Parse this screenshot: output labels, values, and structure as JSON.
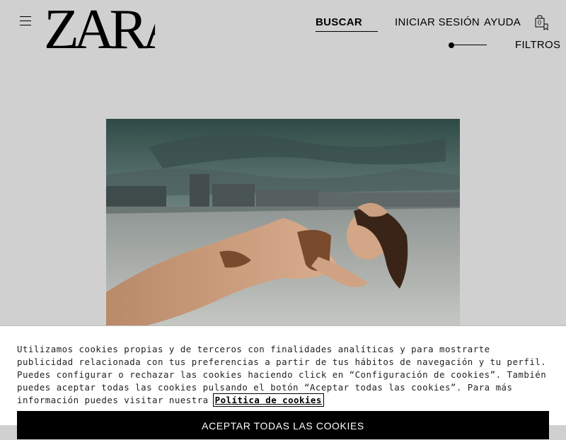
{
  "header": {
    "logo_text": "ZARA",
    "search_label": "BUSCAR",
    "login_label": "INICIAR SESIÓN",
    "help_label": "AYUDA",
    "bag_count": "0",
    "filters_label": "FILTROS"
  },
  "cookie_banner": {
    "text": "Utilizamos cookies propias y de terceros con finalidades analíticas y para mostrarte publicidad relacionada con tus preferencias a partir de tus hábitos de navegación y tu perfil. Puedes configurar o rechazar las cookies haciendo click en “Configuración de cookies”. También puedes aceptar todas las cookies pulsando el botón “Aceptar todas las cookies”. Para más información puedes visitar nuestra",
    "link_label": "Política de cookies",
    "accept_label": "ACEPTAR TODAS LAS COOKIES"
  },
  "colors": {
    "page_background": "#d0d0d0",
    "banner_background": "#ffffff",
    "button_background": "#000000"
  }
}
